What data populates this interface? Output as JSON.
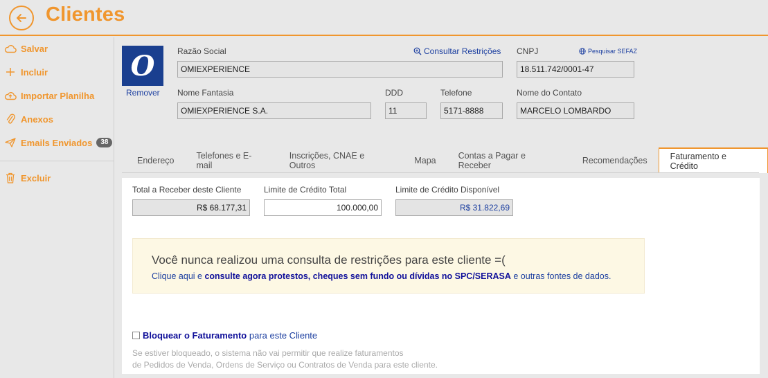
{
  "header": {
    "title": "Clientes"
  },
  "sidebar": {
    "items": [
      {
        "label": "Salvar",
        "icon": "cloud-icon"
      },
      {
        "label": "Incluir",
        "icon": "plus-icon"
      },
      {
        "label": "Importar Planilha",
        "icon": "cloud-upload-icon"
      },
      {
        "label": "Anexos",
        "icon": "paperclip-icon"
      },
      {
        "label": "Emails Enviados",
        "icon": "send-icon",
        "badge": "38"
      },
      {
        "label": "Excluir",
        "icon": "trash-icon"
      }
    ]
  },
  "client": {
    "logo_remove": "Remover",
    "razao_social_label": "Razão Social",
    "razao_social_value": "OMIEXPERIENCE",
    "consultar_link": "Consultar Restrições",
    "cnpj_label": "CNPJ",
    "cnpj_value": "18.511.742/0001-47",
    "sefaz_link": "Pesquisar SEFAZ",
    "nome_fantasia_label": "Nome Fantasia",
    "nome_fantasia_value": "OMIEXPERIENCE S.A.",
    "ddd_label": "DDD",
    "ddd_value": "11",
    "telefone_label": "Telefone",
    "telefone_value": "5171-8888",
    "contato_label": "Nome do Contato",
    "contato_value": "MARCELO LOMBARDO"
  },
  "tabs": [
    "Endereço",
    "Telefones e E-mail",
    "Inscrições, CNAE e Outros",
    "Mapa",
    "Contas a Pagar e Receber",
    "Recomendações",
    "Faturamento e Crédito"
  ],
  "active_tab": "Faturamento e Crédito",
  "billing": {
    "total_receber_label": "Total a Receber deste Cliente",
    "total_receber_value": "R$ 68.177,31",
    "limite_total_label": "Limite de Crédito Total",
    "limite_total_value": "100.000,00",
    "limite_disp_label": "Limite de Crédito Disponível",
    "limite_disp_value": "R$ 31.822,69"
  },
  "notice": {
    "title": "Você nunca realizou uma consulta de restrições para este cliente =(",
    "part1": "Clique aqui e ",
    "part2": "consulte agora protestos, cheques sem fundo ou dívidas no SPC/SERASA",
    "part3": " e outras fontes de dados."
  },
  "block": {
    "label_bold": "Bloquear o Faturamento",
    "label_rest": " para este Cliente",
    "hint1": "Se estiver bloqueado, o sistema não vai permitir que realize faturamentos",
    "hint2": "de Pedidos de Venda, Ordens de Serviço ou Contratos de Venda para este cliente."
  },
  "colors": {
    "accent": "#f0962e",
    "link": "#1c3fa0",
    "logo_bg": "#1a3f8f",
    "notice_bg": "#fdf8e4"
  }
}
